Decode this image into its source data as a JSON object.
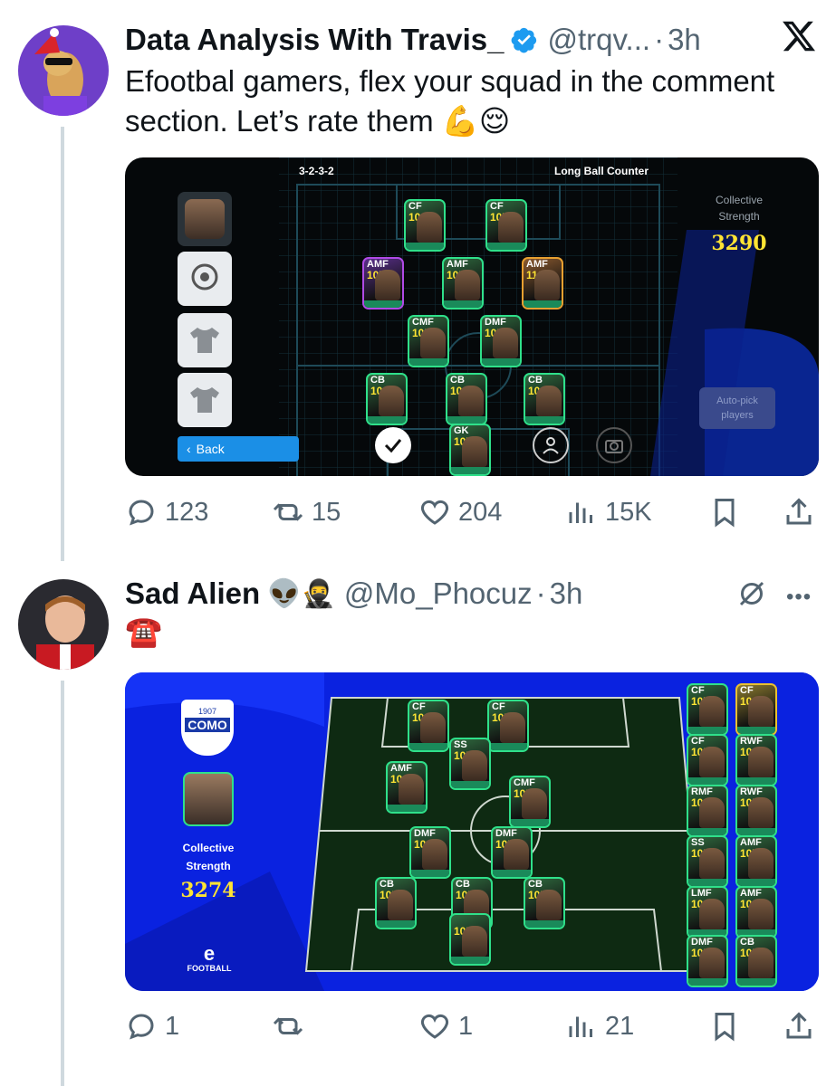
{
  "tweets": [
    {
      "name": "Data Analysis With Travis_",
      "handle": "@trqv...",
      "time": "3h",
      "text": "Efootbal gamers, flex your squad in the comment section. Let’s rate them 💪😌",
      "game": {
        "formation": "3-2-3-2",
        "tactic": "Long Ball Counter",
        "strength_label": "Collective Strength",
        "strength_value": "3290",
        "back_label": "Back",
        "auto_pick": "Auto-pick players",
        "cards": [
          {
            "pos": "CF",
            "rating": "108"
          },
          {
            "pos": "CF",
            "rating": "107"
          },
          {
            "pos": "AMF",
            "rating": "107"
          },
          {
            "pos": "AMF",
            "rating": "105"
          },
          {
            "pos": "AMF",
            "rating": "110"
          },
          {
            "pos": "CMF",
            "rating": "105"
          },
          {
            "pos": "DMF",
            "rating": "105"
          },
          {
            "pos": "CB",
            "rating": "108"
          },
          {
            "pos": "CB",
            "rating": "106"
          },
          {
            "pos": "CB",
            "rating": "104"
          },
          {
            "pos": "GK",
            "rating": "107"
          }
        ]
      },
      "stats": {
        "replies": "123",
        "reposts": "15",
        "likes": "204",
        "views": "15K"
      }
    },
    {
      "name": "Sad Alien",
      "name_emoji": "👽🥷",
      "handle": "@Mo_Phocuz",
      "time": "3h",
      "text": "☎️",
      "game": {
        "club_year": "1907",
        "club_name": "COMO",
        "strength_label_1": "Collective",
        "strength_label_2": "Strength",
        "strength_value": "3274",
        "brand": "FOOTBALL",
        "cards": [
          {
            "pos": "CF",
            "rating": "106"
          },
          {
            "pos": "CF",
            "rating": "105"
          },
          {
            "pos": "SS",
            "rating": "105"
          },
          {
            "pos": "AMF",
            "rating": "106"
          },
          {
            "pos": "CMF",
            "rating": "105"
          },
          {
            "pos": "DMF",
            "rating": "106"
          },
          {
            "pos": "DMF",
            "rating": "105"
          },
          {
            "pos": "CB",
            "rating": "105"
          },
          {
            "pos": "CB",
            "rating": "105"
          },
          {
            "pos": "CB",
            "rating": "105"
          },
          {
            "pos": "",
            "rating": "105"
          }
        ],
        "bench": [
          {
            "pos": "CF",
            "rating": "107"
          },
          {
            "pos": "CF",
            "rating": "106"
          },
          {
            "pos": "CF",
            "rating": "105"
          },
          {
            "pos": "RWF",
            "rating": "108"
          },
          {
            "pos": "RMF",
            "rating": "103"
          },
          {
            "pos": "RWF",
            "rating": "105"
          },
          {
            "pos": "SS",
            "rating": "105"
          },
          {
            "pos": "AMF",
            "rating": "107"
          },
          {
            "pos": "LMF",
            "rating": "106"
          },
          {
            "pos": "AMF",
            "rating": "104"
          },
          {
            "pos": "DMF",
            "rating": "105"
          },
          {
            "pos": "CB",
            "rating": "105"
          }
        ]
      },
      "stats": {
        "replies": "1",
        "reposts": "",
        "likes": "1",
        "views": "21"
      }
    }
  ],
  "colors": {
    "verified": "#1d9bf0",
    "muted": "#536471",
    "text": "#0f1419",
    "line": "#cfd9de",
    "blue_panel": "#0a22e0"
  }
}
